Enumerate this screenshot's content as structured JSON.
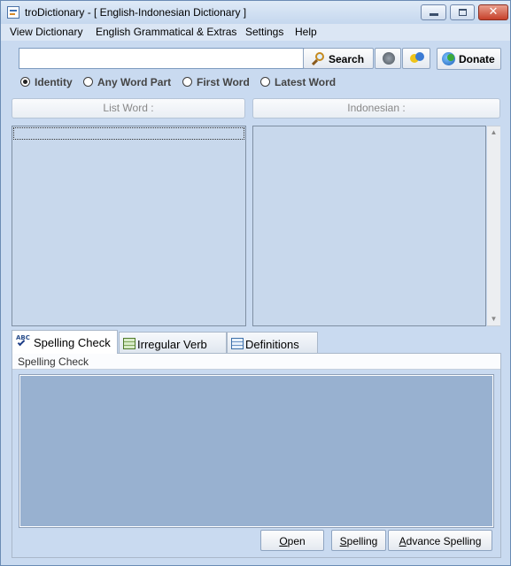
{
  "window": {
    "title": "troDictionary - [ English-Indonesian Dictionary ]"
  },
  "menu": [
    "View Dictionary",
    "English Grammatical & Extras",
    "Settings",
    "Help"
  ],
  "search": {
    "value": "",
    "search_label": "Search",
    "donate_label": "Donate"
  },
  "search_modes": [
    {
      "label": "Identity",
      "checked": true
    },
    {
      "label": "Any Word Part",
      "checked": false
    },
    {
      "label": "First Word",
      "checked": false
    },
    {
      "label": "Latest Word",
      "checked": false
    }
  ],
  "columns": {
    "list_word": "List Word :",
    "indonesian": "Indonesian :"
  },
  "tabs": [
    {
      "label": "Spelling Check",
      "icon": "abc-check-icon",
      "active": true
    },
    {
      "label": "Irregular Verb",
      "icon": "spreadsheet-icon",
      "active": false
    },
    {
      "label": "Definitions",
      "icon": "list-icon",
      "active": false
    }
  ],
  "spelling_panel": {
    "title": "Spelling Check",
    "open_first": "O",
    "open_rest": "pen",
    "spelling_first": "S",
    "spelling_rest": "pelling",
    "advance_first": "A",
    "advance_rest": "dvance Spelling"
  },
  "colors": {
    "window_bg": "#c9daf0",
    "list_bg": "#c8d8ec",
    "spell_area_bg": "#98b1d0",
    "close_button": "#c6402a"
  }
}
